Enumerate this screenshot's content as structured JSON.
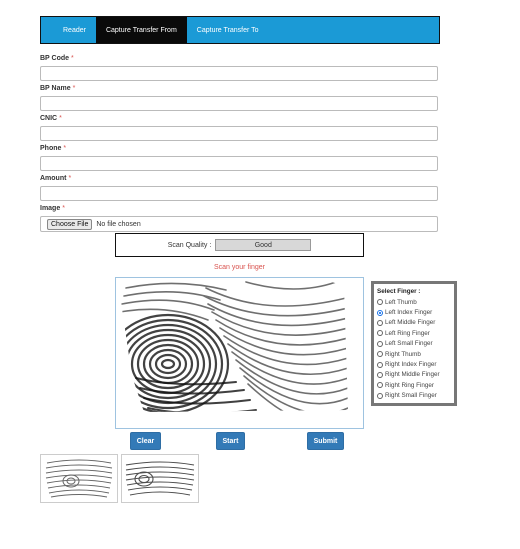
{
  "tabs": [
    {
      "label": "Reader"
    },
    {
      "label": "Capture Transfer From"
    },
    {
      "label": "Capture Transfer To"
    }
  ],
  "form": {
    "bp_code": {
      "label": "BP Code",
      "required": "*",
      "value": ""
    },
    "bp_name": {
      "label": "BP Name",
      "required": "*",
      "value": ""
    },
    "cnic": {
      "label": "CNIC",
      "required": "*",
      "value": ""
    },
    "phone": {
      "label": "Phone",
      "required": "*",
      "value": ""
    },
    "amount": {
      "label": "Amount",
      "required": "*",
      "value": ""
    },
    "image": {
      "label": "Image",
      "required": "*",
      "button": "Choose File",
      "status": "No file chosen"
    }
  },
  "scan": {
    "quality_label": "Scan Quality :",
    "quality_value": "Good",
    "message": "Scan your finger"
  },
  "finger_select": {
    "title": "Select Finger :",
    "selected": "Left Index Finger",
    "options": [
      "Left Thumb",
      "Left Index Finger",
      "Left Middle Finger",
      "Left Ring Finger",
      "Left Small Finger",
      "Right Thumb",
      "Right Index Finger",
      "Right Middle Finger",
      "Right Ring Finger",
      "Right Small Finger"
    ]
  },
  "buttons": {
    "clear": "Clear",
    "start": "Start",
    "submit": "Submit"
  },
  "colors": {
    "tab_bar": "#1b9ad6",
    "active_tab": "#0a0a0a",
    "button": "#337ab7",
    "required": "#d9534f"
  }
}
